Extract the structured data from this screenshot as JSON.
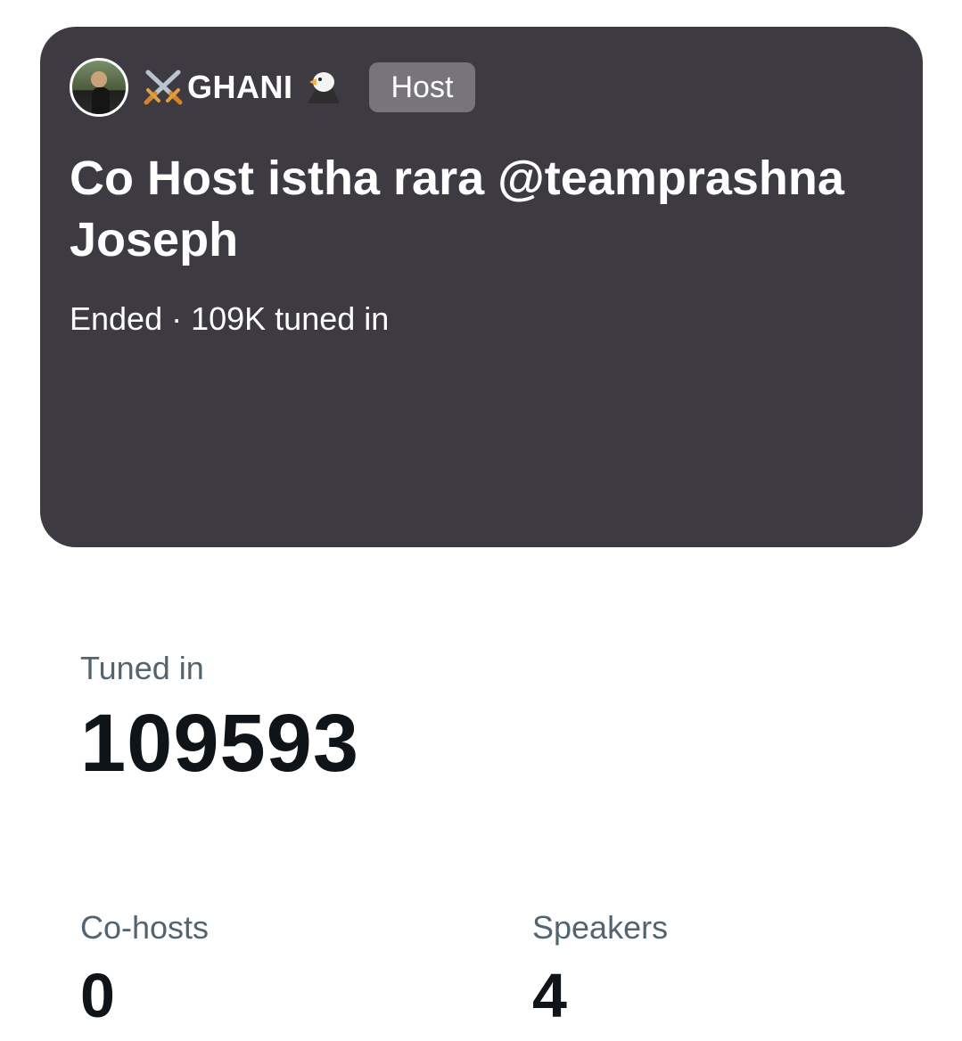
{
  "space": {
    "host_name": "GHANI",
    "host_badge": "Host",
    "title": "Co Host istha rara @teamprashna Joseph",
    "status": "Ended · 109K tuned in",
    "icons": {
      "avatar": "avatar-photo",
      "prefix": "crossed-swords-icon",
      "suffix": "eagle-icon"
    }
  },
  "stats": {
    "tuned_in": {
      "label": "Tuned in",
      "value": "109593"
    },
    "cohosts": {
      "label": "Co-hosts",
      "value": "0"
    },
    "speakers": {
      "label": "Speakers",
      "value": "4"
    }
  },
  "colors": {
    "card_bg": "#3d3a41",
    "badge_bg": "#77747b",
    "label_gray": "#536471",
    "value_black": "#0f1419"
  }
}
